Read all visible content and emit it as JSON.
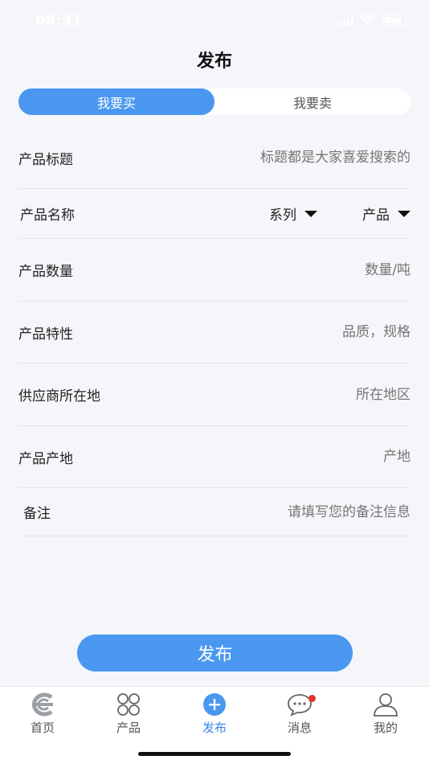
{
  "status": {
    "time": "08:31",
    "battery": "99"
  },
  "header": {
    "title": "发布"
  },
  "segment": {
    "buy": "我要买",
    "sell": "我要卖",
    "active": "buy"
  },
  "form": {
    "title": {
      "label": "产品标题",
      "placeholder": "标题都是大家喜爱搜索的"
    },
    "name": {
      "label": "产品名称",
      "series": "系列",
      "product": "产品"
    },
    "quantity": {
      "label": "产品数量",
      "placeholder": "数量/吨"
    },
    "feature": {
      "label": "产品特性",
      "placeholder": "品质，规格"
    },
    "supplier": {
      "label": "供应商所在地",
      "placeholder": "所在地区"
    },
    "origin": {
      "label": "产品产地",
      "placeholder": "产地"
    },
    "remark": {
      "label": "备注",
      "placeholder": "请填写您的备注信息"
    }
  },
  "submit": {
    "label": "发布"
  },
  "tabbar": {
    "home": "首页",
    "products": "产品",
    "publish": "发布",
    "messages": "消息",
    "mine": "我的"
  },
  "colors": {
    "accent": "#4a97f0",
    "badge": "#e8302e"
  }
}
